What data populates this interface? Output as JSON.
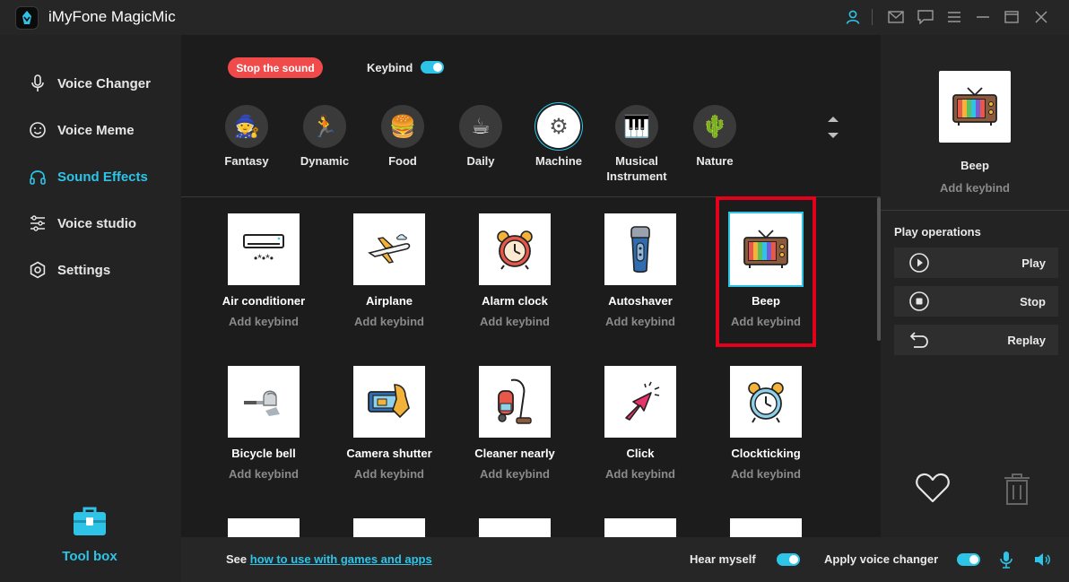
{
  "window": {
    "title": "iMyFone MagicMic"
  },
  "titlebar_icons": [
    "user-icon",
    "mail-icon",
    "feedback-icon",
    "menu-icon",
    "minimize-icon",
    "maximize-icon",
    "close-icon"
  ],
  "sidebar": {
    "items": [
      {
        "label": "Voice Changer",
        "icon": "microphone-icon",
        "active": false
      },
      {
        "label": "Voice Meme",
        "icon": "smiley-icon",
        "active": false
      },
      {
        "label": "Sound Effects",
        "icon": "headphones-icon",
        "active": true
      },
      {
        "label": "Voice studio",
        "icon": "sliders-icon",
        "active": false
      },
      {
        "label": "Settings",
        "icon": "gear-icon",
        "active": false
      }
    ],
    "toolbox_label": "Tool box"
  },
  "main": {
    "stop_label": "Stop the sound",
    "keybind_label": "Keybind",
    "keybind_on": true,
    "categories": [
      {
        "label": "Fantasy",
        "glyph": "🧙"
      },
      {
        "label": "Dynamic",
        "glyph": "🏃"
      },
      {
        "label": "Food",
        "glyph": "🍔"
      },
      {
        "label": "Daily",
        "glyph": "☕"
      },
      {
        "label": "Machine",
        "glyph": "⚙"
      },
      {
        "label": "Musical Instrument",
        "glyph": "🎹"
      },
      {
        "label": "Nature",
        "glyph": "🌵"
      }
    ],
    "active_category": "Machine",
    "sounds": [
      {
        "name": "Air conditioner",
        "keybind": "Add keybind",
        "glyph": "❄"
      },
      {
        "name": "Airplane",
        "keybind": "Add keybind",
        "glyph": "✈"
      },
      {
        "name": "Alarm clock",
        "keybind": "Add keybind",
        "glyph": "⏰"
      },
      {
        "name": "Autoshaver",
        "keybind": "Add keybind",
        "glyph": "🪒"
      },
      {
        "name": "Beep",
        "keybind": "Add keybind",
        "glyph": "📺"
      },
      {
        "name": "Bicycle bell",
        "keybind": "Add keybind",
        "glyph": "🔔"
      },
      {
        "name": "Camera shutter",
        "keybind": "Add keybind",
        "glyph": "📷"
      },
      {
        "name": "Cleaner nearly",
        "keybind": "Add keybind",
        "glyph": "🧹"
      },
      {
        "name": "Click",
        "keybind": "Add keybind",
        "glyph": "🖱"
      },
      {
        "name": "Clockticking",
        "keybind": "Add keybind",
        "glyph": "⏰"
      }
    ],
    "selected_sound": "Beep"
  },
  "right_panel": {
    "preview_name": "Beep",
    "preview_keybind": "Add keybind",
    "ops_title": "Play operations",
    "ops": [
      {
        "label": "Play",
        "icon": "play-icon"
      },
      {
        "label": "Stop",
        "icon": "stop-icon"
      },
      {
        "label": "Replay",
        "icon": "replay-icon"
      }
    ]
  },
  "bottom": {
    "see_prefix": "See ",
    "see_link": "how to use with games and apps",
    "hear_myself_label": "Hear myself",
    "hear_myself_on": true,
    "apply_label": "Apply voice changer",
    "apply_on": true
  },
  "colors": {
    "accent": "#2ec4e8",
    "stop_button": "#f04a4a",
    "highlight_box": "#e3001b"
  }
}
